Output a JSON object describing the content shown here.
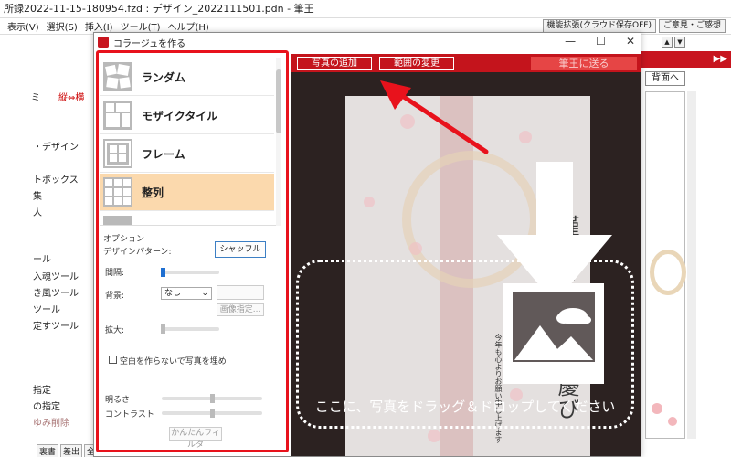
{
  "main_window": {
    "title": "所録2022-11-15-180954.fzd : デザイン_2022111501.pdn - 筆王",
    "menu": [
      "表示(V)",
      "選択(S)",
      "挿入(I)",
      "ツール(T)",
      "ヘルプ(H)"
    ],
    "top_buttons": [
      "機能拡張(クラウド保存OFF)",
      "ご意見・ご感想"
    ],
    "right_header": "▶▶",
    "back_button": "背面へ",
    "left_items": [
      "ミ",
      "縦⇔横",
      "・デザイン",
      "トボックス",
      "集",
      "人",
      "ール",
      "入魂ツール",
      "き風ツール",
      "ツール",
      "定すツール",
      "指定",
      "の指定",
      "ゆみ削除"
    ],
    "bottom_tabs": [
      "裏書",
      "差出",
      "全体"
    ]
  },
  "dialog": {
    "title": "コラージュを作る",
    "window_controls": [
      "—",
      "☐",
      "✕"
    ],
    "styles": [
      {
        "label": "ランダム",
        "icon": "random-collage-icon",
        "selected": false
      },
      {
        "label": "モザイクタイル",
        "icon": "mosaic-tile-icon",
        "selected": false
      },
      {
        "label": "フレーム",
        "icon": "frame-collage-icon",
        "selected": false
      },
      {
        "label": "整列",
        "icon": "grid-align-icon",
        "selected": true
      }
    ],
    "options": {
      "heading": "オプション",
      "design_pattern_label": "デザインパターン:",
      "shuffle_label": "シャッフル",
      "spacing_label": "間隔:",
      "spacing_value": 0.0,
      "background_label": "背景:",
      "background_value": "なし",
      "image_select_label": "画像指定...",
      "zoom_label": "拡大:",
      "no_gap_label": "空白を作らないで写真を埋め",
      "brightness_label": "明るさ",
      "brightness_value": 0.5,
      "contrast_label": "コントラスト",
      "contrast_value": 0.5,
      "easy_filter_label": "かんたんフィルタ"
    },
    "canvas": {
      "add_photo_label": "写真の追加",
      "change_range_label": "範囲の変更",
      "send_label": "筆王に送る",
      "greeting_text": "謹んで新春のお慶びを申し上げます",
      "small_text": "今年も心よりお願い申し上げます",
      "drop_hint": "ここに、写真をドラッグ＆ドロップしてください"
    }
  },
  "colors": {
    "brand_red": "#c4141c",
    "highlight_red": "#e8121c",
    "selected_item": "#fbd9ad",
    "canvas_bg": "#2c2221",
    "slider_blue": "#1f6fd1"
  }
}
